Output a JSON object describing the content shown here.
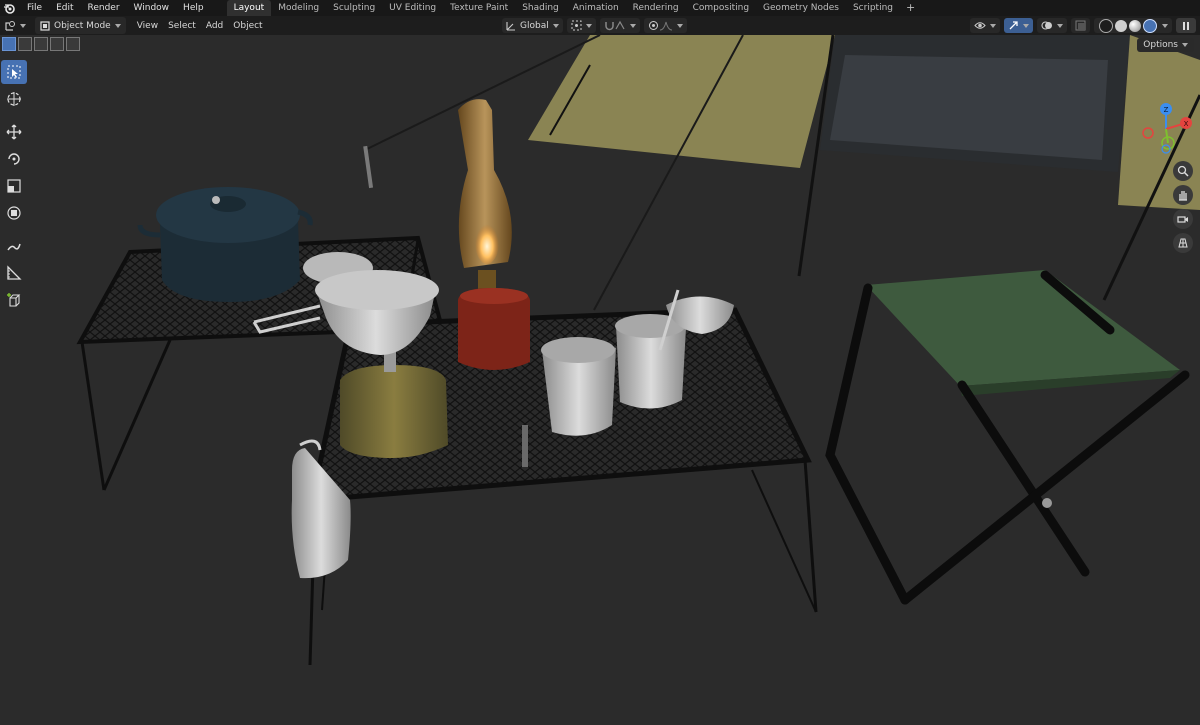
{
  "menu": {
    "items": [
      "File",
      "Edit",
      "Render",
      "Window",
      "Help"
    ]
  },
  "workspaces": {
    "tabs": [
      "Layout",
      "Modeling",
      "Sculpting",
      "UV Editing",
      "Texture Paint",
      "Shading",
      "Animation",
      "Rendering",
      "Compositing",
      "Geometry Nodes",
      "Scripting"
    ],
    "active": "Layout",
    "add_label": "+"
  },
  "viewport_header": {
    "mode_label": "Object Mode",
    "menus": [
      "View",
      "Select",
      "Add",
      "Object"
    ],
    "orientation_label": "Global",
    "options_label": "Options"
  },
  "colors": {
    "accent": "#4772b3",
    "background": "#2b2b2b",
    "x_axis": "#e4443f",
    "y_axis": "#7ec02f",
    "z_axis": "#3b8ef0"
  },
  "gizmo": {
    "x_label": "X",
    "y_label": "Y",
    "z_label": "Z"
  },
  "toolbar": {
    "tools": [
      "select-box-icon",
      "cursor-icon",
      "move-icon",
      "rotate-icon",
      "scale-icon",
      "transform-icon",
      "annotate-icon",
      "measure-icon",
      "add-cube-icon"
    ]
  },
  "nav": {
    "buttons": [
      "zoom-icon",
      "pan-hand-icon",
      "camera-icon",
      "grid-icon"
    ]
  }
}
